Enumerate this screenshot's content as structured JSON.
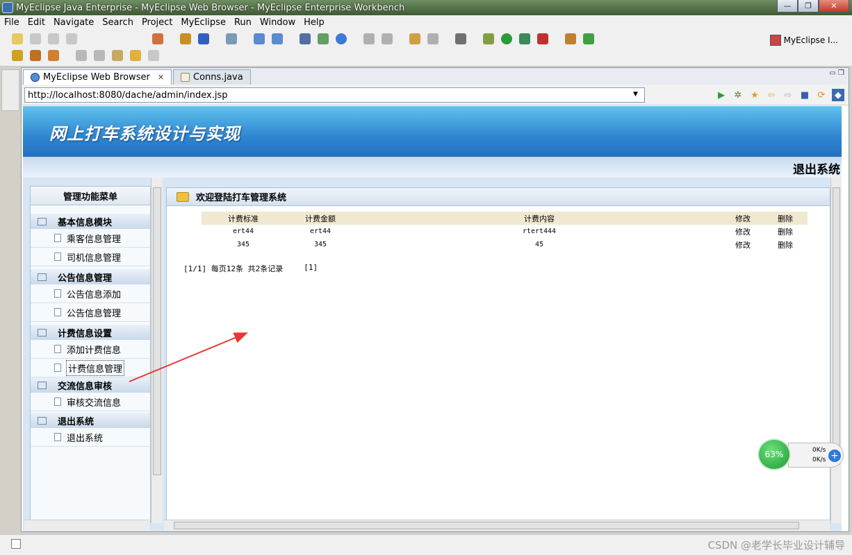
{
  "window": {
    "title": "MyEclipse Java Enterprise - MyEclipse Web Browser - MyEclipse Enterprise Workbench",
    "minimize": "—",
    "maximize": "❐",
    "close": "✕"
  },
  "menubar": [
    "File",
    "Edit",
    "Navigate",
    "Search",
    "Project",
    "MyEclipse",
    "Run",
    "Window",
    "Help"
  ],
  "perspective": {
    "label": "MyEclipse I..."
  },
  "tabs": [
    {
      "label": "MyEclipse Web Browser",
      "close": "✕",
      "active": true
    },
    {
      "label": "Conns.java",
      "active": false
    }
  ],
  "browser": {
    "url": "http://localhost:8080/dache/admin/index.jsp",
    "dropdown": "▼",
    "nav_icons": [
      "go-icon",
      "debug-icon",
      "favorite-icon",
      "back-icon",
      "forward-icon",
      "stop-icon",
      "refresh-icon",
      "myeclipse-icon"
    ]
  },
  "page": {
    "banner_title": "网上打车系统设计与实现",
    "logout_top": "退出系统",
    "sidebar": {
      "header": "管理功能菜单",
      "sections": [
        {
          "title": "基本信息模块",
          "items": [
            "乘客信息管理",
            "司机信息管理"
          ]
        },
        {
          "title": "公告信息管理",
          "items": [
            "公告信息添加",
            "公告信息管理"
          ]
        },
        {
          "title": "计费信息设置",
          "items": [
            "添加计费信息",
            "计费信息管理"
          ]
        },
        {
          "title": "交流信息审核",
          "items": [
            "审核交流信息"
          ]
        },
        {
          "title": "退出系统",
          "items": [
            "退出系统"
          ]
        }
      ]
    },
    "main": {
      "title": "欢迎登陆打车管理系统",
      "table": {
        "headers": [
          "计费标准",
          "计费金额",
          "计费内容",
          "修改",
          "删除"
        ],
        "rows": [
          [
            "ert44",
            "ert44",
            "rtert444",
            "修改",
            "删除"
          ],
          [
            "345",
            "345",
            "45",
            "修改",
            "删除"
          ]
        ]
      },
      "pager": {
        "info": "[1/1] 每页12条 共2条记录",
        "page_link": "[1]"
      }
    }
  },
  "net_widget": {
    "percent": "63%",
    "up": "0K/s",
    "down": "0K/s",
    "plus": "+"
  },
  "statusbar": {
    "watermark": "CSDN @老学长毕业设计辅导"
  },
  "colors": {
    "banner": "#2f86d0",
    "annotation_arrow": "#e53935",
    "widget_green": "#1d9a33"
  }
}
